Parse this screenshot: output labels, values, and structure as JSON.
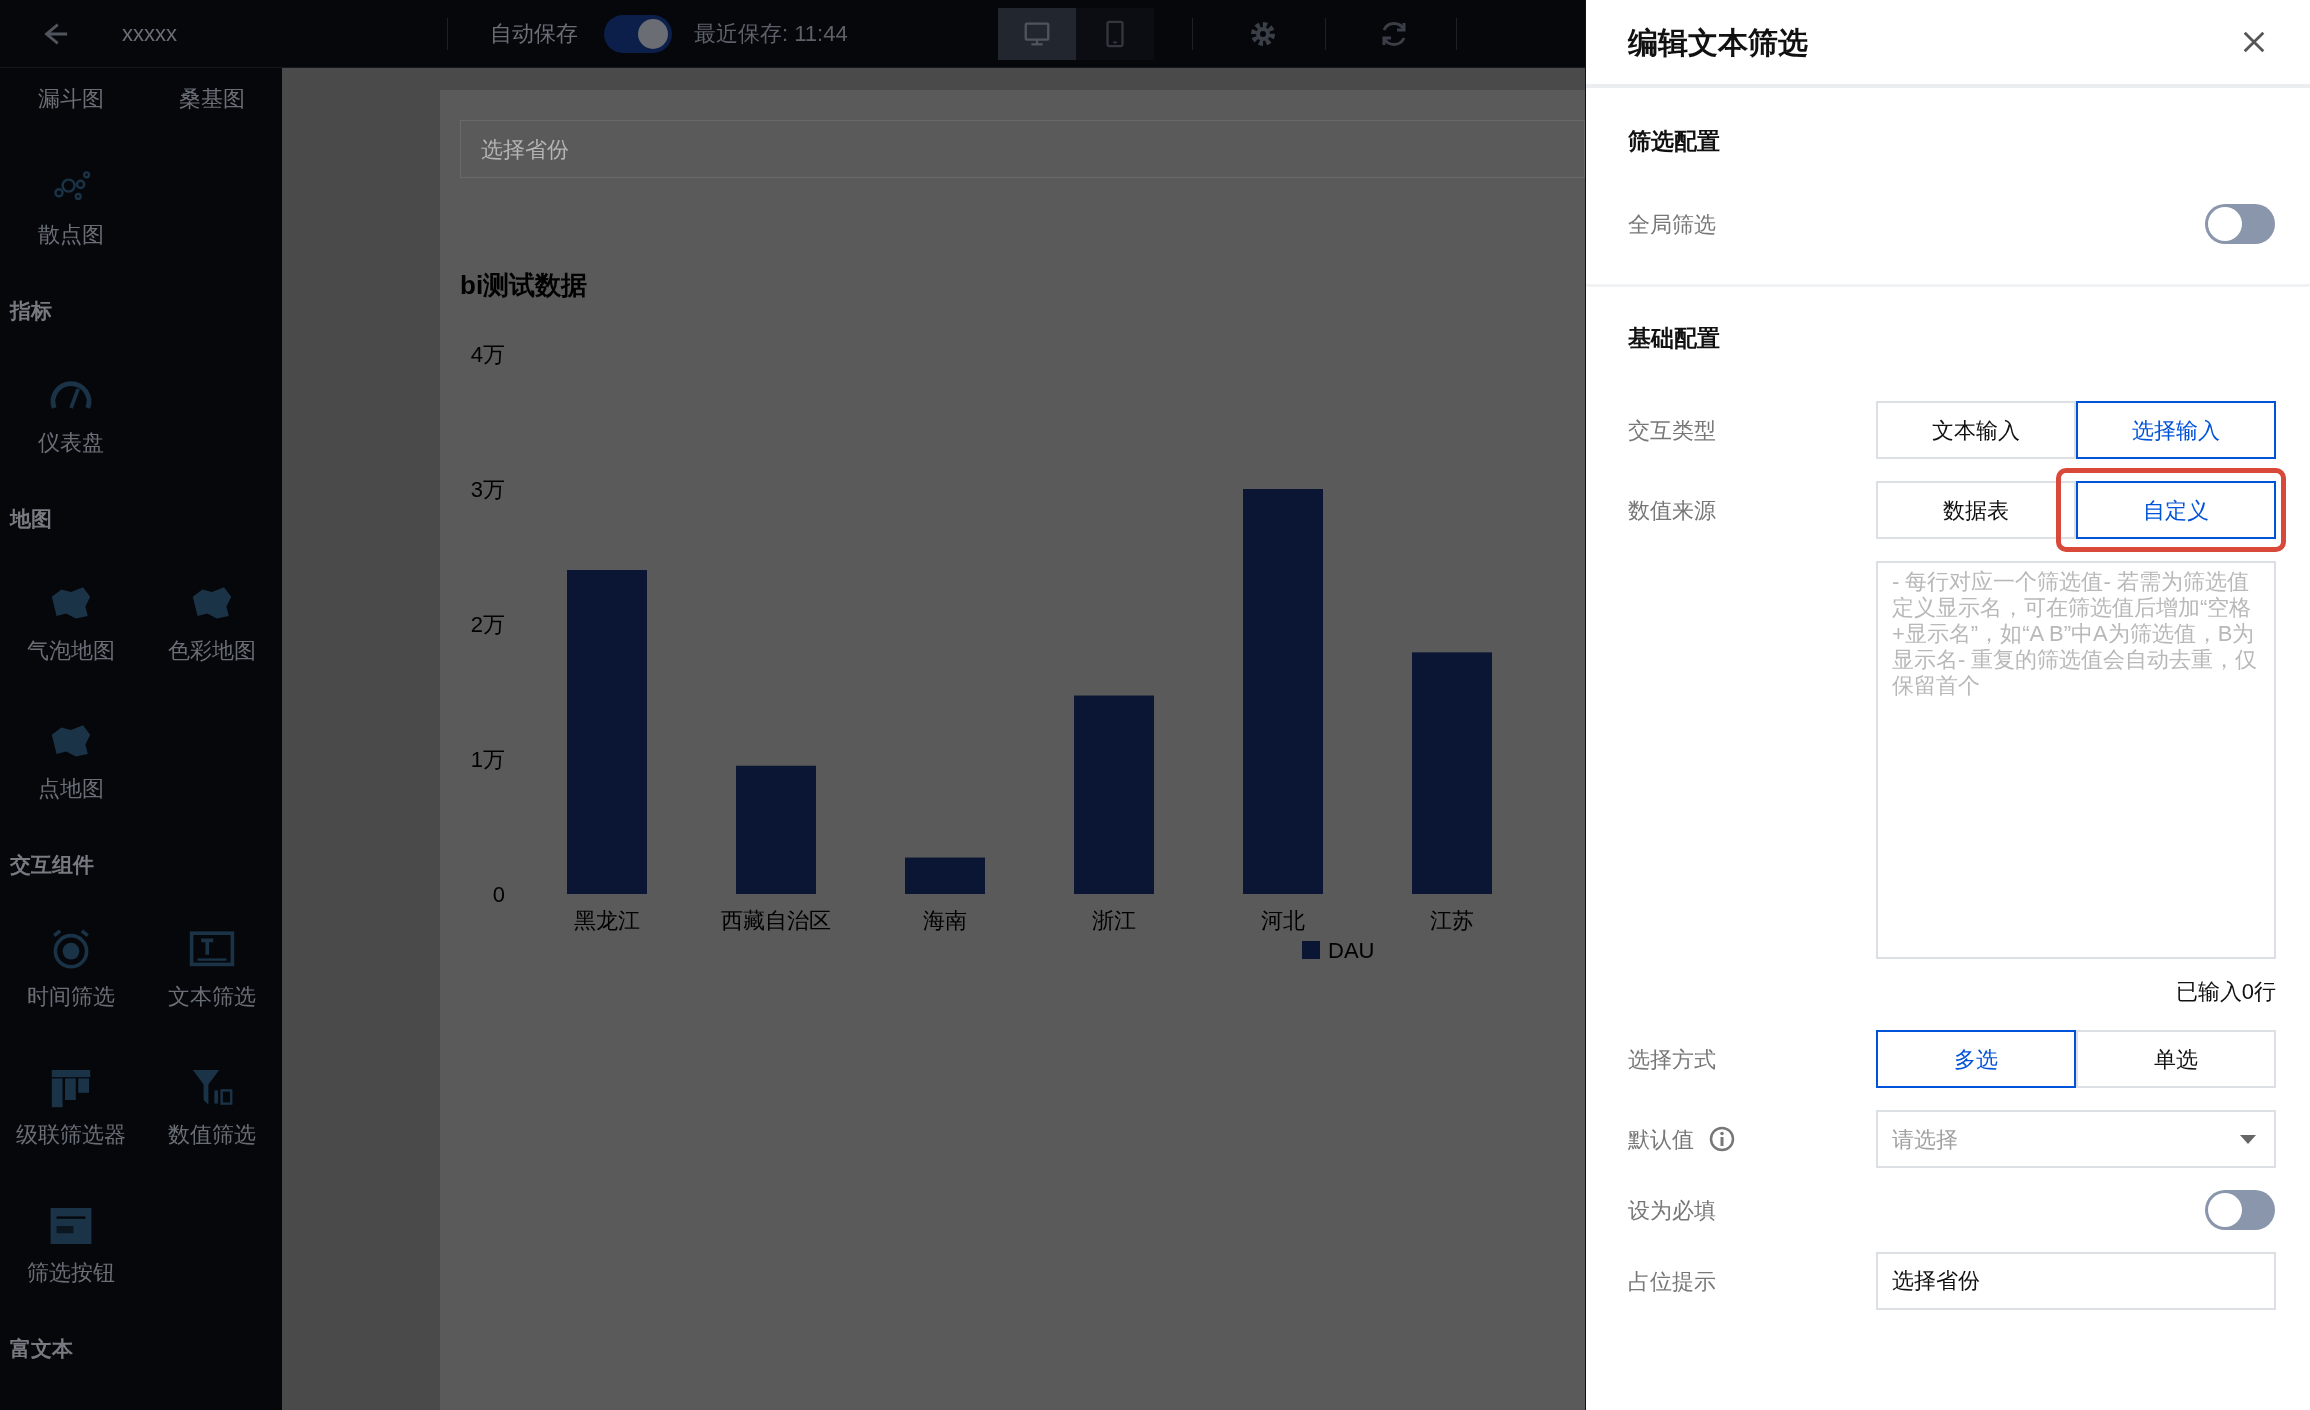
{
  "top_bar": {
    "title": "xxxxx",
    "auto_save": {
      "label": "自动保存",
      "on": true
    },
    "last_saved": "最近保存: 11:44",
    "devices": [
      {
        "kind": "desktop",
        "selected": true
      },
      {
        "kind": "mobile",
        "selected": false
      }
    ]
  },
  "sidebar": {
    "sections": [
      {
        "items": [
          {
            "label": "漏斗图",
            "kind": "plain"
          },
          {
            "label": "桑基图",
            "kind": "plain"
          },
          {
            "label": "散点图",
            "kind": "scatter"
          }
        ]
      },
      {
        "title": "指标",
        "items": [
          {
            "label": "仪表盘",
            "kind": "gauge"
          }
        ]
      },
      {
        "title": "地图",
        "items": [
          {
            "label": "气泡地图",
            "kind": "map"
          },
          {
            "label": "色彩地图",
            "kind": "map"
          },
          {
            "label": "点地图",
            "kind": "map"
          }
        ]
      },
      {
        "title": "交互组件",
        "items": [
          {
            "label": "时间筛选",
            "kind": "clock"
          },
          {
            "label": "文本筛选",
            "kind": "text"
          },
          {
            "label": "级联筛选器",
            "kind": "cascade"
          },
          {
            "label": "数值筛选",
            "kind": "funnel"
          },
          {
            "label": "筛选按钮",
            "kind": "panel"
          }
        ]
      },
      {
        "title": "富文本"
      }
    ]
  },
  "canvas": {
    "filter_field": {
      "placeholder": "选择省份"
    },
    "card": {
      "title": "bi测试数据",
      "chart_data": {
        "type": "bar",
        "categories": [
          "黑龙江",
          "西藏自治区",
          "海南",
          "浙江",
          "河北",
          "江苏"
        ],
        "series": [
          {
            "name": "DAU",
            "color": "#0a1633",
            "values": [
              2.4,
              0.95,
              0.27,
              1.47,
              3.0,
              1.79
            ]
          }
        ],
        "ylim": [
          0,
          4
        ],
        "yticks": [
          {
            "value": 0,
            "label": "0"
          },
          {
            "value": 1,
            "label": "1万"
          },
          {
            "value": 2,
            "label": "2万"
          },
          {
            "value": 3,
            "label": "3万"
          },
          {
            "value": 4,
            "label": "4万"
          }
        ]
      }
    }
  },
  "panel": {
    "title": "编辑文本筛选",
    "sections": [
      {
        "title": "筛选配置",
        "rows": [
          {
            "kind": "toggle",
            "label": "全局筛选",
            "on": false
          }
        ]
      },
      {
        "title": "基础配置",
        "rows": [
          {
            "kind": "segmented",
            "label": "交互类型",
            "options": [
              {
                "label": "文本输入",
                "selected": false,
                "highlighted": false
              },
              {
                "label": "选择输入",
                "selected": true,
                "highlighted": false
              }
            ]
          },
          {
            "kind": "segmented",
            "label": "数值来源",
            "options": [
              {
                "label": "数据表",
                "selected": false,
                "highlighted": false
              },
              {
                "label": "自定义",
                "selected": true,
                "highlighted": true
              }
            ]
          },
          {
            "kind": "textarea",
            "placeholder": "- 每行对应一个筛选值- 若需为筛选值定义显示名，可在筛选值后增加“空格+显示名”，如“A B”中A为筛选值，B为显示名- 重复的筛选值会自动去重，仅保留首个",
            "count": "已输入0行"
          },
          {
            "kind": "segmented",
            "label": "选择方式",
            "options": [
              {
                "label": "多选",
                "selected": true,
                "highlighted": false
              },
              {
                "label": "单选",
                "selected": false,
                "highlighted": false
              }
            ]
          },
          {
            "kind": "select",
            "label": "默认值",
            "info": true,
            "placeholder": "请选择"
          },
          {
            "kind": "toggle",
            "label": "设为必填",
            "on": false
          },
          {
            "kind": "input",
            "label": "占位提示",
            "value": "选择省份"
          }
        ]
      }
    ]
  }
}
